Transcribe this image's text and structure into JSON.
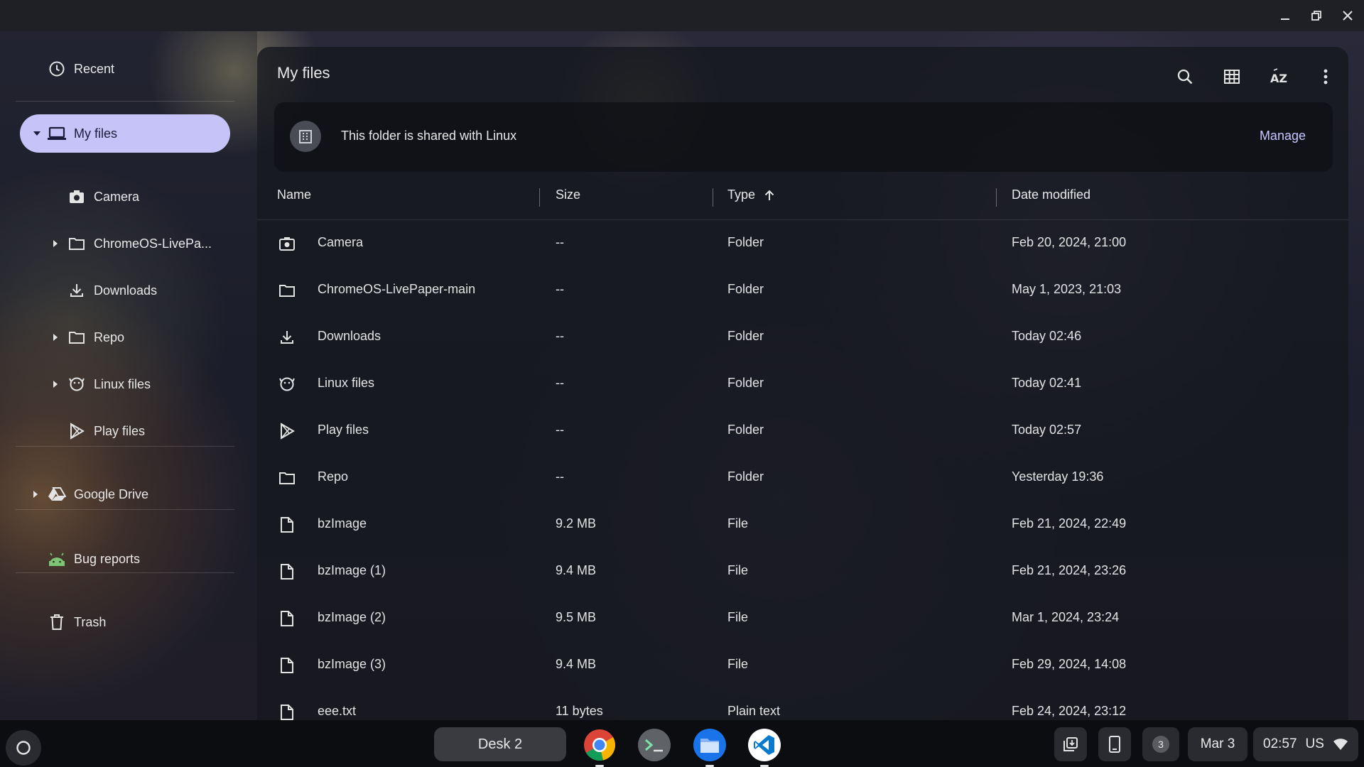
{
  "window": {
    "title_controls": [
      "minimize",
      "restore",
      "close"
    ]
  },
  "sidebar": {
    "recent": "Recent",
    "my_files": "My files",
    "camera": "Camera",
    "livepaper": "ChromeOS-LivePa...",
    "downloads": "Downloads",
    "repo": "Repo",
    "linux_files": "Linux files",
    "play_files": "Play files",
    "google_drive": "Google Drive",
    "bug_reports": "Bug reports",
    "trash": "Trash"
  },
  "main": {
    "title": "My files",
    "banner_text": "This folder is shared with Linux",
    "banner_action": "Manage",
    "columns": {
      "name": "Name",
      "size": "Size",
      "type": "Type",
      "date": "Date modified"
    },
    "sort": {
      "column": "Type",
      "direction": "ascending"
    },
    "rows": [
      {
        "icon": "camera-icon",
        "name": "Camera",
        "size": "--",
        "type": "Folder",
        "date": "Feb 20, 2024, 21:00"
      },
      {
        "icon": "folder-icon",
        "name": "ChromeOS-LivePaper-main",
        "size": "--",
        "type": "Folder",
        "date": "May 1, 2023, 21:03"
      },
      {
        "icon": "download-icon",
        "name": "Downloads",
        "size": "--",
        "type": "Folder",
        "date": "Today 02:46"
      },
      {
        "icon": "linux-icon",
        "name": "Linux files",
        "size": "--",
        "type": "Folder",
        "date": "Today 02:41"
      },
      {
        "icon": "play-icon",
        "name": "Play files",
        "size": "--",
        "type": "Folder",
        "date": "Today 02:57"
      },
      {
        "icon": "folder-icon",
        "name": "Repo",
        "size": "--",
        "type": "Folder",
        "date": "Yesterday 19:36"
      },
      {
        "icon": "file-icon",
        "name": "bzImage",
        "size": "9.2 MB",
        "type": "File",
        "date": "Feb 21, 2024, 22:49"
      },
      {
        "icon": "file-icon",
        "name": "bzImage (1)",
        "size": "9.4 MB",
        "type": "File",
        "date": "Feb 21, 2024, 23:26"
      },
      {
        "icon": "file-icon",
        "name": "bzImage (2)",
        "size": "9.5 MB",
        "type": "File",
        "date": "Mar 1, 2024, 23:24"
      },
      {
        "icon": "file-icon",
        "name": "bzImage (3)",
        "size": "9.4 MB",
        "type": "File",
        "date": "Feb 29, 2024, 14:08"
      },
      {
        "icon": "file-icon",
        "name": "eee.txt",
        "size": "11 bytes",
        "type": "Plain text",
        "date": "Feb 24, 2024, 23:12"
      }
    ]
  },
  "shelf": {
    "desk_label": "Desk 2",
    "apps": [
      "chrome-icon",
      "terminal-icon",
      "files-icon",
      "vscode-icon"
    ],
    "notification_count": "3",
    "date": "Mar 3",
    "time": "02:57",
    "locale": "US"
  },
  "colors": {
    "selected_bg": "#c5c3f7",
    "accent_text": "#c9c7ff",
    "bug_reports_icon": "#7cc576"
  }
}
